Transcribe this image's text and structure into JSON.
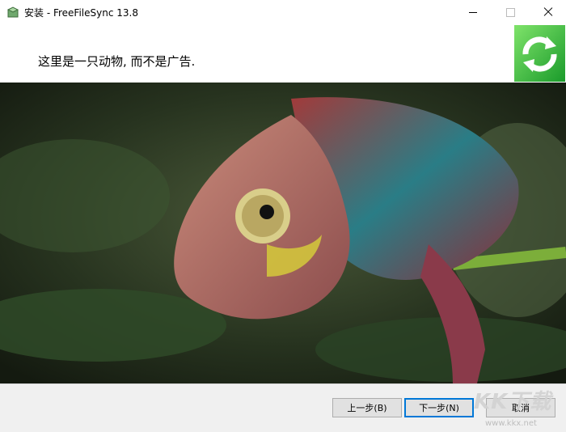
{
  "window": {
    "title": "安装 - FreeFileSync 13.8",
    "icon": "installer-box-icon"
  },
  "header": {
    "text": "这里是一只动物, 而不是广告.",
    "logo_icon": "sync-arrows-icon",
    "logo_color": "#18a32a"
  },
  "photo": {
    "subject": "chameleon-image"
  },
  "footer": {
    "back_label": "上一步(B)",
    "next_label": "下一步(N)",
    "cancel_label": "取消",
    "watermark_text": "KK下载",
    "watermark_url": "www.kkx.net"
  }
}
